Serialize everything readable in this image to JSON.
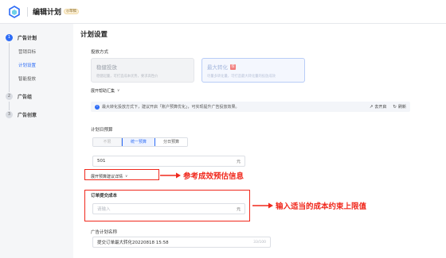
{
  "header": {
    "title": "编辑计划",
    "draft_badge": "◎草稿"
  },
  "sidebar": {
    "steps": [
      {
        "num": "1",
        "label": "广告计划",
        "sub": [
          "营销目标",
          "计划设置",
          "智能投放"
        ]
      },
      {
        "num": "2",
        "label": "广告组"
      },
      {
        "num": "3",
        "label": "广告创意"
      }
    ]
  },
  "main": {
    "section_title": "计划设置",
    "delivery_label": "投放方式",
    "cards": [
      {
        "title": "稳健投放",
        "desc": "稳健起量，可打造成本优势，要求高性价",
        "badge": ""
      },
      {
        "title": "最大转化",
        "desc": "尽量多转化量，可打造最大转化量的投放成效",
        "badge": "荐"
      }
    ],
    "help_label": "展开帮助汇集",
    "help_chevron": "∨",
    "info_text": "最大转化投放方式下，建议开启「账户预算优化」，可实现提升广告投放效果。",
    "info_actions": [
      {
        "icon": "↗",
        "label": "去开启"
      },
      {
        "icon": "↻",
        "label": "刷新"
      }
    ],
    "budget_label": "计划日预算",
    "budget_modes": [
      "不限",
      "统一预算",
      "分日预算"
    ],
    "budget_value": "501",
    "budget_unit": "元",
    "budget_tips_label": "展开预算建议详情",
    "budget_tips_chevron": "∨",
    "cost_label": "订单提交成本",
    "cost_placeholder": "请输入",
    "cost_unit": "元",
    "name_label": "广告计划名称",
    "name_value": "提交订单最大转化20220818 15:58",
    "name_counter": "33/100"
  },
  "annotations": {
    "note1": "参考成效预估信息",
    "note2": "输入适当的成本约束上限值",
    "color": "#f0281c"
  },
  "colors": {
    "accent": "#2d6cf6",
    "annotation": "#f0281c"
  }
}
